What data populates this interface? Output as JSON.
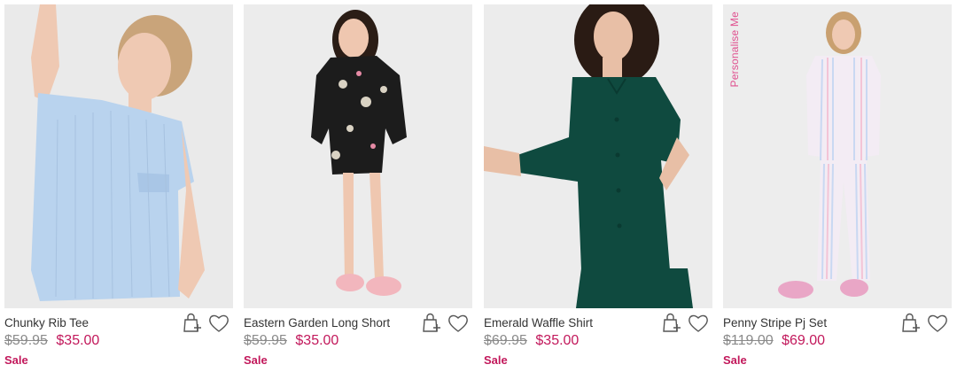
{
  "products": [
    {
      "name": "Chunky Rib Tee",
      "was_price": "$59.95",
      "price": "$35.00",
      "badge": "Sale",
      "personalise": "",
      "colors": {
        "garment": "#b9d3ee",
        "background": "#eaeaea",
        "skin": "#efc9b3",
        "hair": "#c9a47a"
      }
    },
    {
      "name": "Eastern Garden Long Short",
      "was_price": "$59.95",
      "price": "$35.00",
      "badge": "Sale",
      "personalise": "",
      "colors": {
        "garment": "#1c1c1c",
        "background": "#ececec",
        "skin": "#efc7b0",
        "hair": "#2b1d16"
      }
    },
    {
      "name": "Emerald Waffle Shirt",
      "was_price": "$69.95",
      "price": "$35.00",
      "badge": "Sale",
      "personalise": "",
      "colors": {
        "garment": "#0f4a3f",
        "background": "#ececec",
        "skin": "#e8bfa6",
        "hair": "#2a1b14"
      }
    },
    {
      "name": "Penny Stripe Pj Set",
      "was_price": "$119.00",
      "price": "$69.00",
      "badge": "Sale",
      "personalise": "Personalise Me",
      "colors": {
        "garment": "#f3ecf4",
        "background": "#ededed",
        "skin": "#efc9b3",
        "hair": "#c9a070"
      }
    }
  ],
  "icons": {
    "add_to_bag": "bag-plus-icon",
    "wishlist": "heart-icon"
  },
  "accent_color": "#c2185b"
}
